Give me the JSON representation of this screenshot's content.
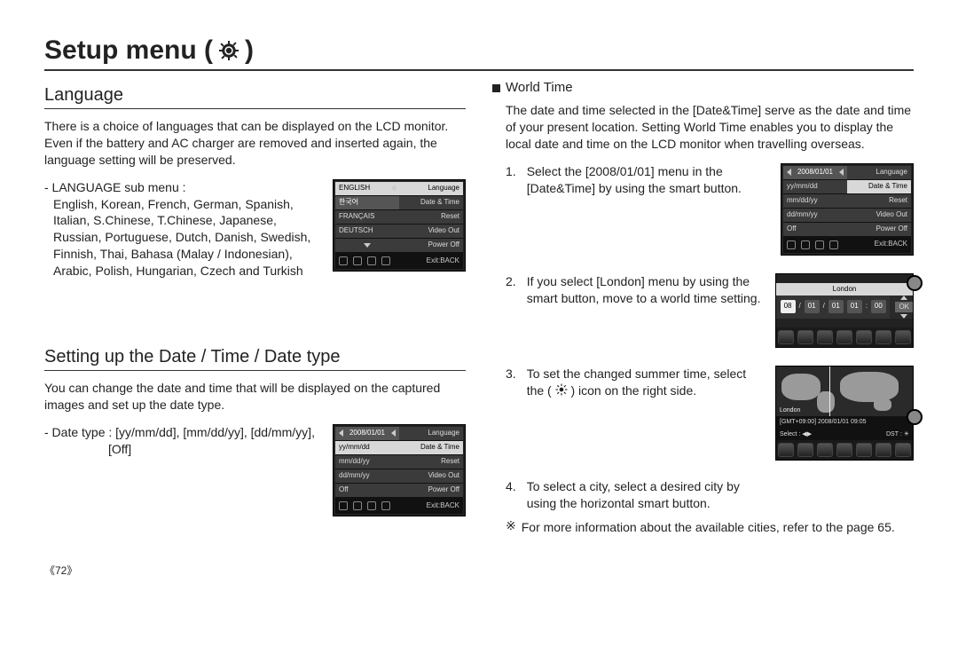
{
  "title": "Setup menu (",
  "title_close": ")",
  "left": {
    "language_heading": "Language",
    "language_para": "There is a choice of languages that can be displayed on the LCD monitor. Even if the battery and AC charger are removed and inserted again, the language setting will be preserved.",
    "lang_sub_label": "- LANGUAGE sub menu :",
    "lang_sub_list": "English, Korean, French, German, Spanish, Italian, S.Chinese, T.Chinese, Japanese, Russian, Portuguese, Dutch, Danish, Swedish, Finnish, Thai, Bahasa (Malay / Indonesian), Arabic, Polish, Hungarian, Czech and Turkish",
    "datetime_heading": "Setting up the Date / Time / Date type",
    "datetime_para": "You can change the date and time that will be displayed on the captured images and set up the date type.",
    "datetype_line": "- Date type : [yy/mm/dd], [mm/dd/yy], [dd/mm/yy],",
    "datetype_off": "[Off]"
  },
  "right": {
    "world_heading": "World Time",
    "world_para": "The date and time selected in the [Date&Time] serve as the date and time of your present location. Setting World Time enables you to display the local date and time on the LCD monitor when travelling overseas.",
    "step1_num": "1.",
    "step1": "Select the [2008/01/01] menu in the [Date&Time] by using the smart button.",
    "step2_num": "2.",
    "step2": "If you select [London] menu by using the smart button, move to a world time setting.",
    "step3_num": "3.",
    "step3_a": "To set the changed summer time, select the (",
    "step3_b": ") icon on the right side.",
    "step4_num": "4.",
    "step4": "To select a city, select a desired city by using the horizontal smart button.",
    "note_mark": "※",
    "note": "For more information about the available cities, refer to the page 65."
  },
  "lcd_lang": {
    "left": [
      "ENGLISH",
      "한국어",
      "FRANÇAIS",
      "DEUTSCH"
    ],
    "right": [
      "Language",
      "Date & Time",
      "Reset",
      "Video Out",
      "Power Off"
    ],
    "exit": "Exit:BACK"
  },
  "lcd_date": {
    "left_top": "2008/01/01",
    "left": [
      "yy/mm/dd",
      "mm/dd/yy",
      "dd/mm/yy",
      "Off"
    ],
    "right": [
      "Language",
      "Date & Time",
      "Reset",
      "Video Out",
      "Power Off"
    ],
    "exit": "Exit:BACK"
  },
  "lcd_world1": {
    "left_top": "2008/01/01",
    "left": [
      "yy/mm/dd",
      "mm/dd/yy",
      "dd/mm/yy",
      "Off"
    ],
    "right": [
      "Language",
      "Date & Time",
      "Reset",
      "Video Out",
      "Power Off"
    ],
    "exit": "Exit:BACK"
  },
  "lcd_world2": {
    "city": "London",
    "date": "08 / 01 / 01 01 : 00",
    "ok": "OK"
  },
  "lcd_world3": {
    "city": "London",
    "gmt": "[GMT+09:00] 2008/01/01 09:05",
    "select": "Select :",
    "dst": "DST :"
  },
  "page_number": "《72》"
}
